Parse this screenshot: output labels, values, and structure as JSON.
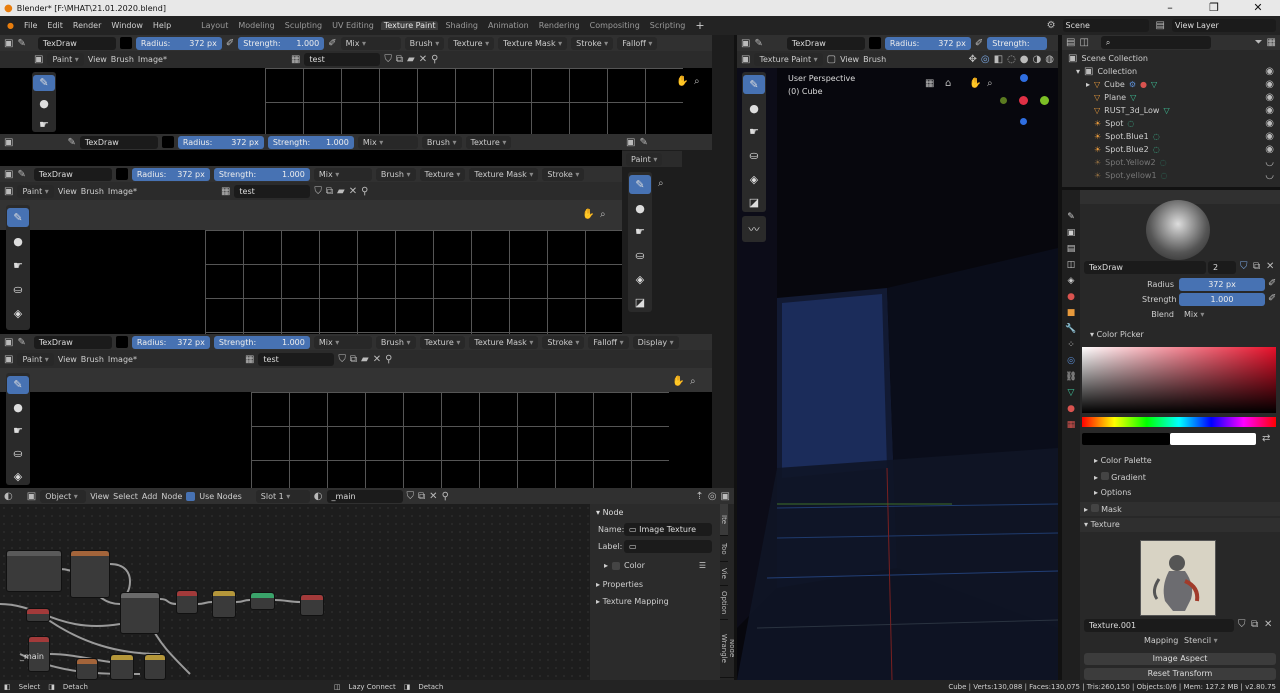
{
  "window": {
    "title": "Blender* [F:\\MHAT\\21.01.2020.blend]"
  },
  "menu": {
    "items": [
      "File",
      "Edit",
      "Render",
      "Window",
      "Help"
    ]
  },
  "workspaces": [
    "Layout",
    "Modeling",
    "Sculpting",
    "UV Editing",
    "Texture Paint",
    "Shading",
    "Animation",
    "Rendering",
    "Compositing",
    "Scripting"
  ],
  "active_workspace_index": 4,
  "scene": {
    "label": "Scene",
    "view_layer": "View Layer"
  },
  "brush": {
    "name": "TexDraw",
    "radius_label": "Radius:",
    "radius": "372 px",
    "strength_label": "Strength:",
    "strength": "1.000",
    "blend": "Mix"
  },
  "tool_header": {
    "brush": "Brush",
    "texture": "Texture",
    "texture_mask": "Texture Mask",
    "stroke": "Stroke",
    "falloff": "Falloff",
    "display": "Display"
  },
  "image_header": {
    "mode": "Paint",
    "view": "View",
    "brush": "Brush",
    "image": "Image*",
    "image_name": "test"
  },
  "viewport": {
    "mode": "Texture Paint",
    "view": "View",
    "brush": "Brush",
    "perspective": "User Perspective",
    "object": "(0) Cube"
  },
  "outliner": {
    "collection_root": "Scene Collection",
    "collection": "Collection",
    "items": [
      "Cube",
      "Plane",
      "RUST_3d_Low",
      "Spot",
      "Spot.Blue1",
      "Spot.Blue2",
      "Spot.Yellow2",
      "Spot.yellow1"
    ]
  },
  "properties": {
    "brush_name": "TexDraw",
    "brush_users": "2",
    "radius_label": "Radius",
    "radius": "372 px",
    "strength_label": "Strength",
    "strength": "1.000",
    "blend_label": "Blend",
    "blend": "Mix",
    "color_picker": "Color Picker",
    "color_palette": "Color Palette",
    "gradient": "Gradient",
    "options": "Options",
    "mask": "Mask",
    "texture": "Texture",
    "texture_name": "Texture.001",
    "mapping_label": "Mapping",
    "mapping": "Stencil",
    "image_aspect": "Image Aspect",
    "reset_transform": "Reset Transform"
  },
  "node_editor": {
    "mode": "Object",
    "view": "View",
    "select": "Select",
    "add": "Add",
    "node": "Node",
    "use_nodes": "Use Nodes",
    "slot": "Slot 1",
    "material": "_main",
    "frame_label": "_main"
  },
  "node_panel": {
    "section": "Node",
    "name_label": "Name:",
    "name": "Image Texture",
    "label_label": "Label:",
    "color": "Color",
    "properties": "Properties",
    "texture_mapping": "Texture Mapping",
    "tabs": [
      "Ite",
      "Too",
      "Vie",
      "Option",
      "Node Wrangle"
    ]
  },
  "status": {
    "left1": "Select",
    "left2": "Detach",
    "mid1": "Lazy Connect",
    "mid2": "Detach",
    "right": "Cube | Verts:130,088 | Faces:130,075 | Tris:260,150 | Objects:0/6 | Mem: 127.2 MB | v2.80.75"
  }
}
